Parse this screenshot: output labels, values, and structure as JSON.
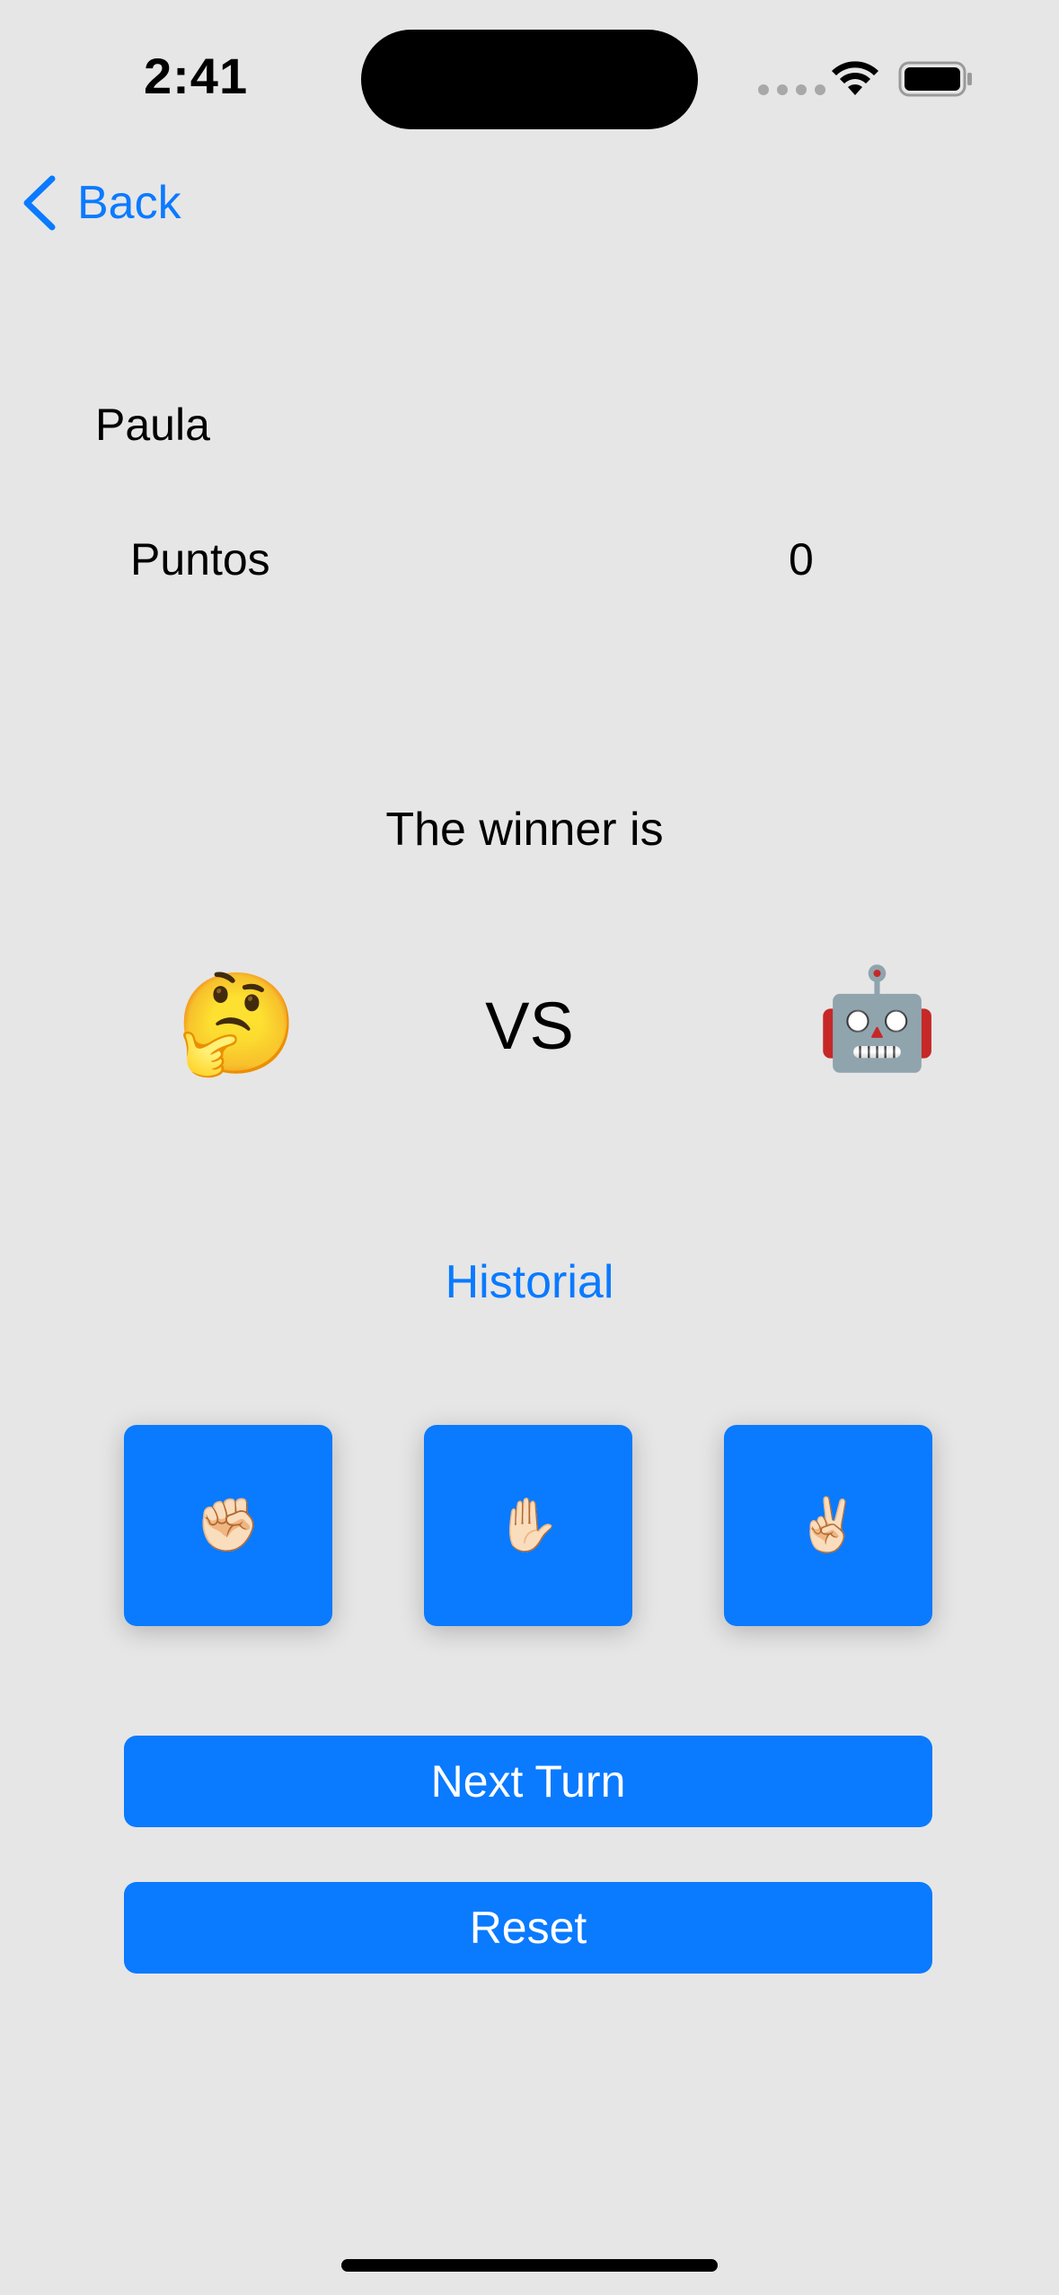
{
  "status_bar": {
    "time": "2:41",
    "wifi_icon": "wifi-icon",
    "battery_icon": "battery-icon"
  },
  "nav": {
    "back_label": "Back"
  },
  "player": {
    "name": "Paula",
    "points_label": "Puntos",
    "points_value": "0"
  },
  "result": {
    "winner_text": "The winner is",
    "player_emoji": "🤔",
    "vs_text": "VS",
    "cpu_emoji": "🤖"
  },
  "history_label": "Historial",
  "choices": [
    {
      "name": "rock",
      "emoji": "✊🏻"
    },
    {
      "name": "paper",
      "emoji": "✋🏻"
    },
    {
      "name": "scissors",
      "emoji": "✌🏻"
    }
  ],
  "actions": {
    "next_turn_label": "Next Turn",
    "reset_label": "Reset"
  },
  "colors": {
    "accent": "#0a7aff",
    "background": "#e6e6e6"
  }
}
